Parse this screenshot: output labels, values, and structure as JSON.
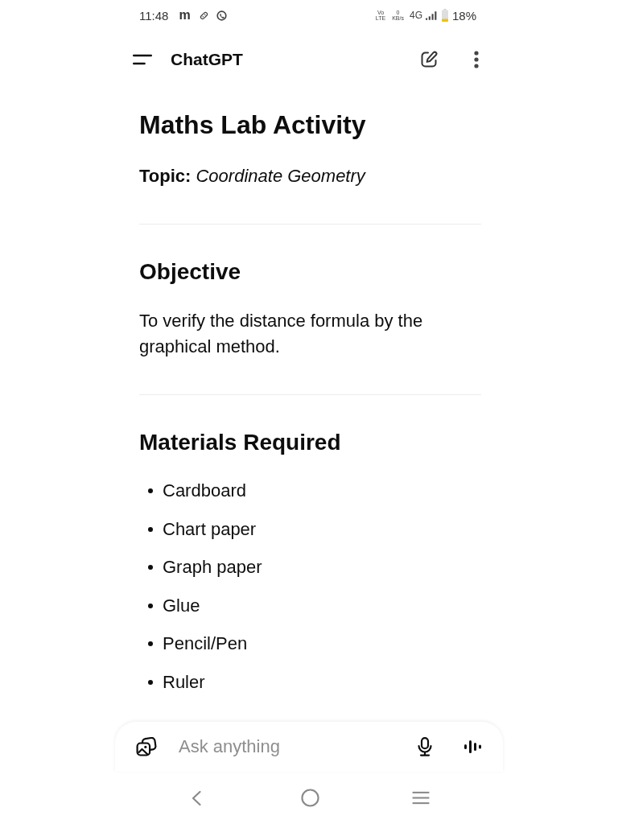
{
  "status_bar": {
    "time": "11:48",
    "notification": "m",
    "volte": [
      "Vo",
      "LTE"
    ],
    "speed": [
      "0",
      "KB/s"
    ],
    "network": "4G",
    "battery": "18%"
  },
  "app_bar": {
    "title": "ChatGPT"
  },
  "message": {
    "title": "Maths Lab Activity",
    "topic": "**Topic:** *Coordinate Geometry*",
    "sections": [
      {
        "kind": "paragraph",
        "heading": "Objective",
        "text": "To verify the distance formula by the graphical method."
      },
      {
        "kind": "list",
        "heading": "Materials Required",
        "items": [
          "Cardboard",
          "Chart paper",
          "Graph paper",
          "Glue",
          "Pencil/Pen",
          "Ruler"
        ]
      }
    ]
  },
  "composer": {
    "placeholder": "Ask anything"
  }
}
